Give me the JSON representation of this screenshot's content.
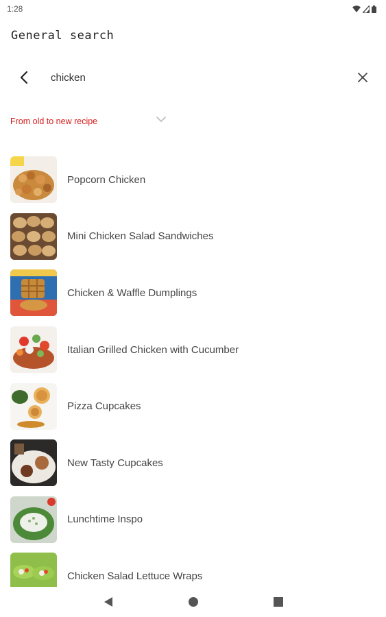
{
  "status_bar": {
    "time": "1:28"
  },
  "header": {
    "title": "General search"
  },
  "search": {
    "value": "chicken",
    "placeholder": ""
  },
  "sort": {
    "label": "From old to new recipe"
  },
  "recipes": [
    {
      "title": "Popcorn Chicken",
      "thumb": "popcorn-chicken"
    },
    {
      "title": "Mini Chicken Salad Sandwiches",
      "thumb": "sandwiches"
    },
    {
      "title": "Chicken & Waffle Dumplings",
      "thumb": "waffle"
    },
    {
      "title": "Italian Grilled Chicken with Cucumber",
      "thumb": "grilled-chicken"
    },
    {
      "title": "Pizza Cupcakes",
      "thumb": "pizza-cupcakes"
    },
    {
      "title": "New Tasty Cupcakes",
      "thumb": "cupcakes"
    },
    {
      "title": "Lunchtime Inspo",
      "thumb": "salad"
    },
    {
      "title": "Chicken Salad Lettuce Wraps",
      "thumb": "lettuce-wraps"
    }
  ],
  "colors": {
    "accent": "#d51c1c",
    "text": "#444444"
  }
}
